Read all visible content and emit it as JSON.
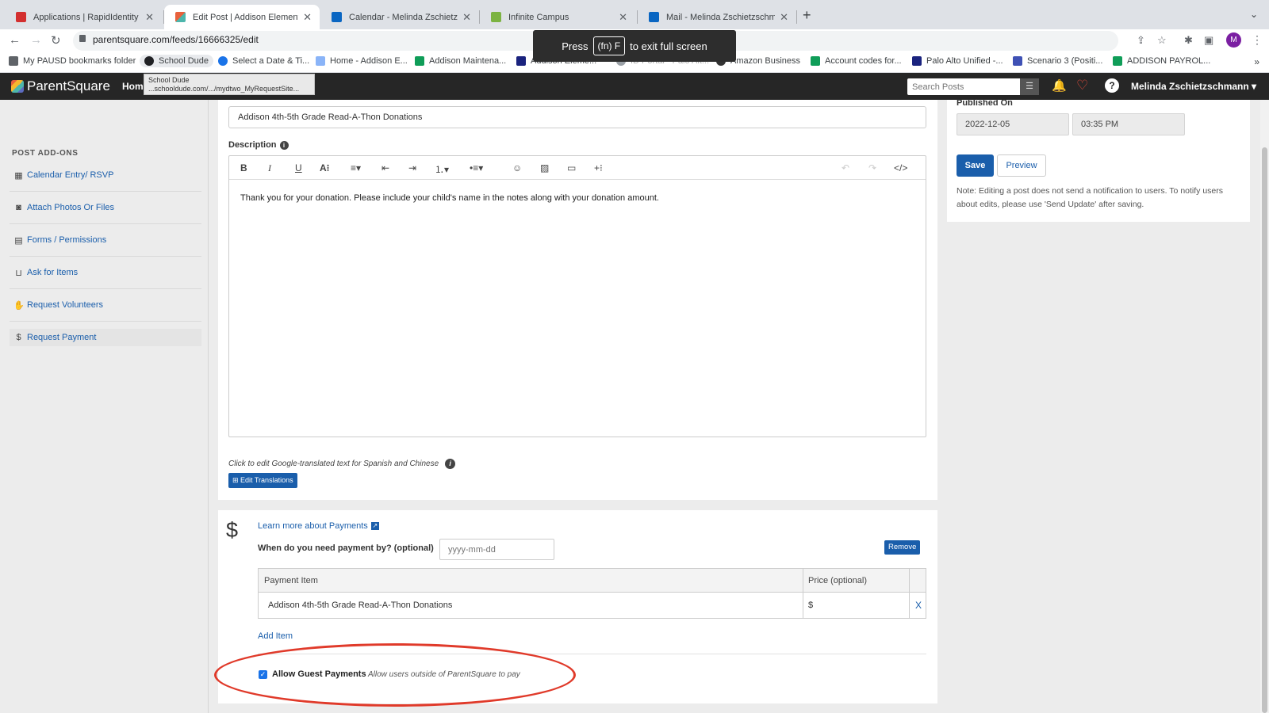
{
  "browser": {
    "tabs": [
      {
        "title": "Applications | RapidIdentity",
        "color": "#d32f2f"
      },
      {
        "title": "Edit Post | Addison Elementary",
        "color": "#f5a623"
      },
      {
        "title": "Calendar - Melinda Zschietzschmann",
        "color": "#0a66c2"
      },
      {
        "title": "Infinite Campus",
        "color": "#7cb342"
      },
      {
        "title": "Mail - Melinda Zschietzschmann",
        "color": "#0a66c2"
      }
    ],
    "new_tab": "+",
    "url": "parentsquare.com/feeds/16666325/edit",
    "profile_initial": "M",
    "bookmarks": [
      {
        "label": "My PAUSD bookmarks folder",
        "color": "#5f6368"
      },
      {
        "label": "School Dude",
        "color": "#202124"
      },
      {
        "label": "Select a Date & Ti...",
        "color": "#1a73e8"
      },
      {
        "label": "Home - Addison E...",
        "color": "#8ab4f8"
      },
      {
        "label": "Addison Maintena...",
        "color": "#0f9d58"
      },
      {
        "label": "Addison Eleme...",
        "color": "#1a237e"
      },
      {
        "label": "ID Portal - Palo Alt...",
        "color": "#9aa0a6"
      },
      {
        "label": "Amazon Business",
        "color": "#333333"
      },
      {
        "label": "Account codes for...",
        "color": "#0f9d58"
      },
      {
        "label": "Palo Alto Unified -...",
        "color": "#1a237e"
      },
      {
        "label": "Scenario 3 (Positi...",
        "color": "#3f51b5"
      },
      {
        "label": "ADDISON PAYROL...",
        "color": "#0f9d58"
      }
    ],
    "fullscreen_toast": {
      "press": "Press",
      "key": "(fn) F",
      "rest": "to exit full screen"
    },
    "tooltip": {
      "title": "School Dude",
      "url": "...schooldude.com/.../mydtwo_MyRequestSite..."
    }
  },
  "app": {
    "brand": "ParentSquare",
    "home_label": "Home",
    "search_placeholder": "Search Posts",
    "user_name": "Melinda Zschietzschmann"
  },
  "sidebar": {
    "heading": "POST ADD-ONS",
    "items": [
      {
        "label": "Calendar Entry/ RSVP",
        "icon": "calendar-icon"
      },
      {
        "label": "Attach Photos Or Files",
        "icon": "camera-icon"
      },
      {
        "label": "Forms / Permissions",
        "icon": "document-icon"
      },
      {
        "label": "Ask for Items",
        "icon": "basket-icon"
      },
      {
        "label": "Request Volunteers",
        "icon": "hand-icon"
      },
      {
        "label": "Request Payment",
        "icon": "dollar-icon"
      }
    ]
  },
  "post": {
    "title_value": "Addison 4th-5th Grade Read-A-Thon Donations",
    "description_label": "Description",
    "description_text": "Thank you for your donation. Please include your child's name in the notes along with your donation amount.",
    "translate_note": "Click to edit Google-translated text for Spanish and Chinese",
    "edit_translations": "Edit Translations"
  },
  "publish": {
    "label": "Published On",
    "date": "2022-12-05",
    "time": "03:35 PM",
    "save": "Save",
    "preview": "Preview",
    "note": "Note: Editing a post does not send a notification to users. To notify users about edits, please use 'Send Update' after saving."
  },
  "payment": {
    "learn_more": "Learn more about Payments",
    "due_label": "When do you need payment by? (optional)",
    "due_placeholder": "yyyy-mm-dd",
    "remove": "Remove",
    "col_item": "Payment Item",
    "col_price": "Price (optional)",
    "rows": [
      {
        "item": "Addison 4th-5th Grade Read-A-Thon Donations",
        "currency": "$",
        "remove": "X"
      }
    ],
    "add_item": "Add Item",
    "guest_label": "Allow Guest Payments",
    "guest_hint": "Allow users outside of ParentSquare to pay",
    "guest_checked": true
  },
  "colors": {
    "accent": "#1a5eab",
    "annotation": "#e03a2a",
    "header": "#262626"
  }
}
